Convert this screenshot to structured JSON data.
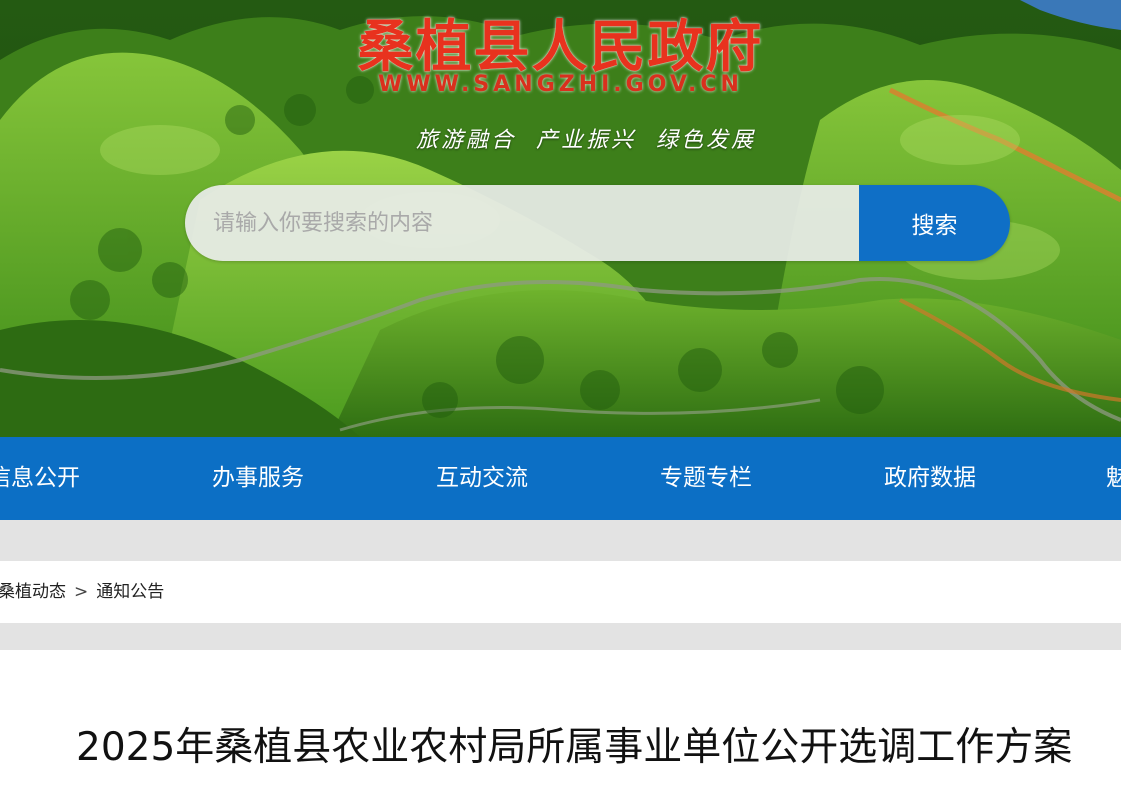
{
  "header": {
    "site_title": "桑植县人民政府",
    "site_url": "WWW.SANGZHI.GOV.CN",
    "slogan": "旅游融合 产业振兴 绿色发展"
  },
  "search": {
    "placeholder": "请输入你要搜索的内容",
    "value": "",
    "button_label": "搜索"
  },
  "nav": {
    "items": [
      {
        "label": "信息公开"
      },
      {
        "label": "办事服务"
      },
      {
        "label": "互动交流"
      },
      {
        "label": "专题专栏"
      },
      {
        "label": "政府数据"
      },
      {
        "label": "魅"
      }
    ]
  },
  "breadcrumb": {
    "items": [
      {
        "label": "桑植动态"
      },
      {
        "label": "通知公告"
      }
    ],
    "separator": ">"
  },
  "article": {
    "title": "2025年桑植县农业农村局所属事业单位公开选调工作方案"
  },
  "colors": {
    "brand_blue": "#0c6fc5",
    "title_red": "#e8321e",
    "gray_strip": "#e3e3e3"
  }
}
